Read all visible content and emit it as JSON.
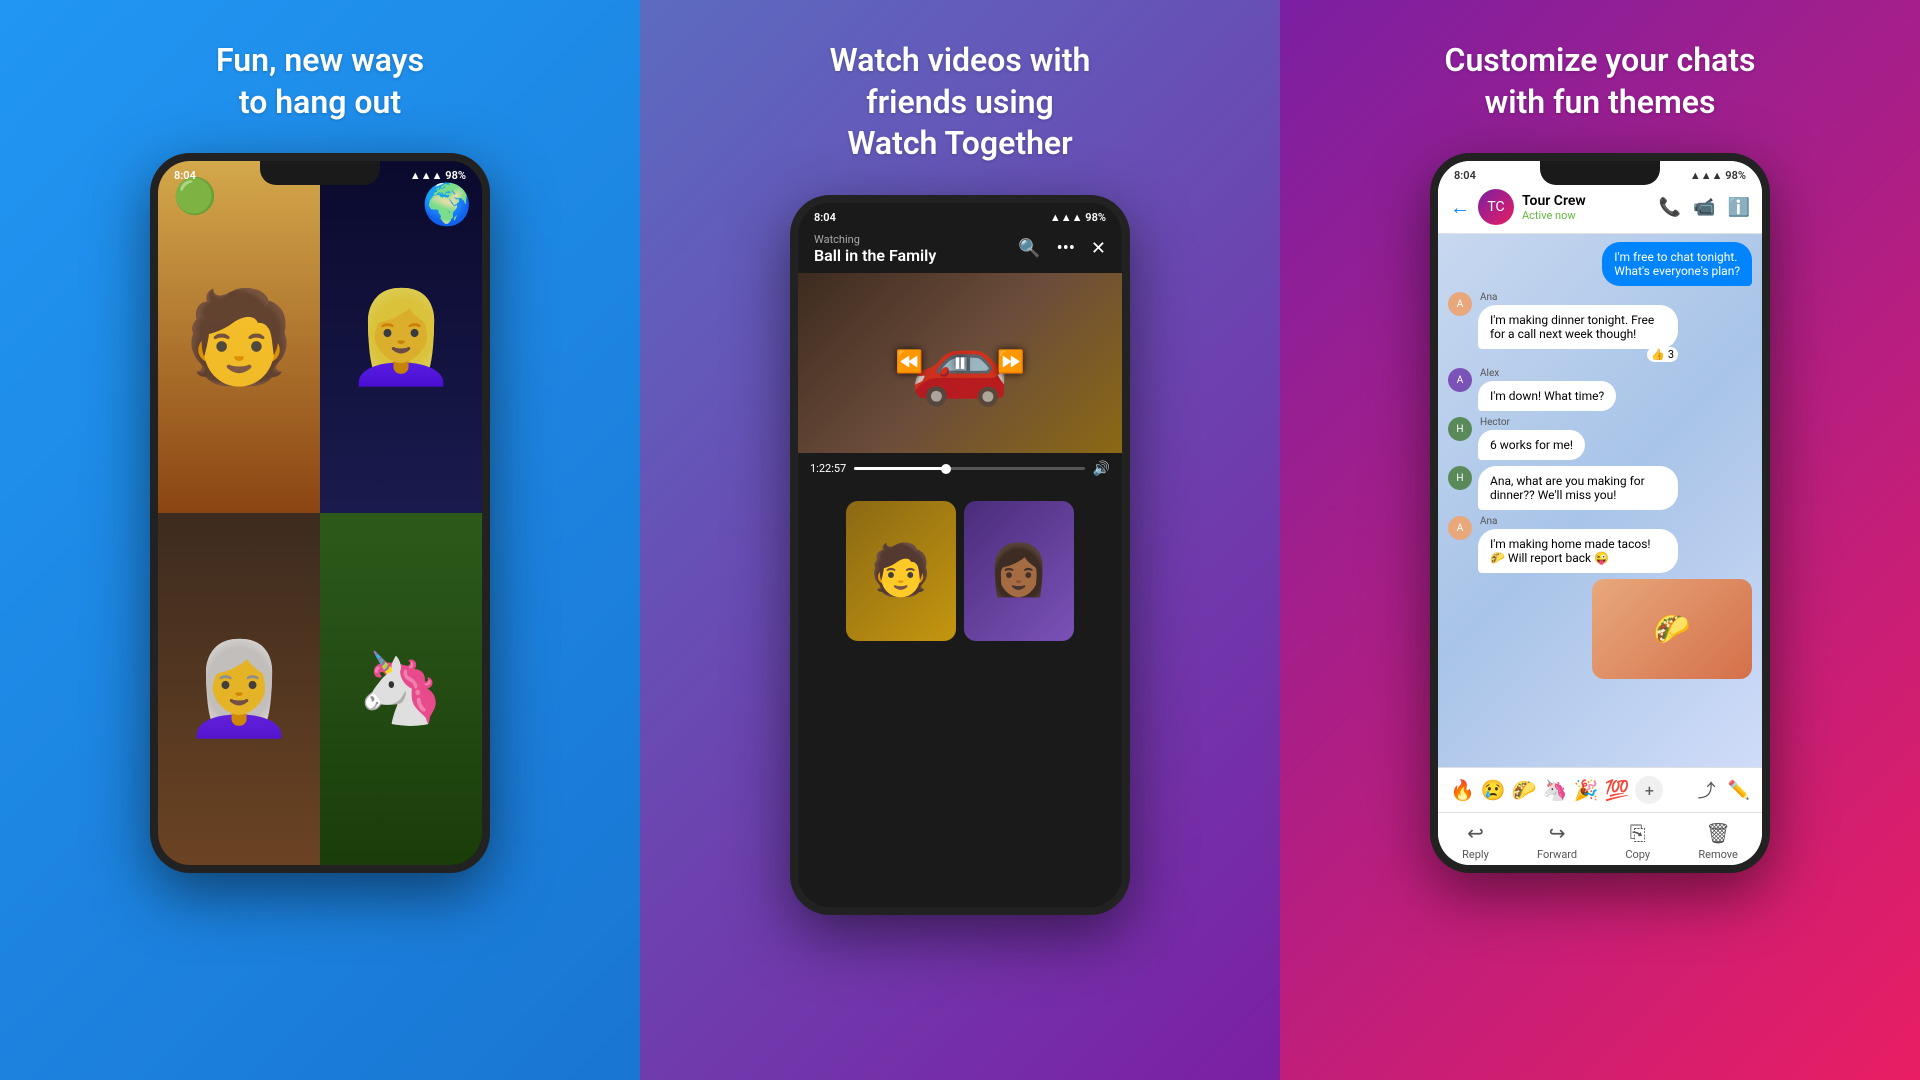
{
  "panels": [
    {
      "id": "panel-1",
      "title": "Fun, new ways\nto hang out",
      "background": "blue"
    },
    {
      "id": "panel-2",
      "title": "Watch videos with\nfriends using\nWatch Together",
      "background": "purple"
    },
    {
      "id": "panel-3",
      "title": "Customize your chats\nwith fun themes",
      "background": "pink-purple"
    }
  ],
  "phone1": {
    "status_bar": {
      "time": "8:04",
      "battery": "98%"
    }
  },
  "phone2": {
    "status_bar": {
      "time": "8:04",
      "battery": "98%"
    },
    "watching_label": "Watching",
    "video_title": "Ball in the Family",
    "timestamp": "1:22:57"
  },
  "phone3": {
    "status_bar": {
      "time": "8:04",
      "battery": "98%"
    },
    "chat": {
      "group_name": "Tour Crew",
      "group_status": "Active now",
      "messages": [
        {
          "type": "sent",
          "text": "I'm free to chat tonight. What's everyone's plan?"
        },
        {
          "type": "received",
          "sender": "Ana",
          "text": "I'm making dinner tonight. Free for a call next week though!",
          "reaction": "👍 3"
        },
        {
          "type": "received",
          "sender": "Alex",
          "text": "I'm down! What time?"
        },
        {
          "type": "received",
          "sender": "Hector",
          "text": "6 works for me!"
        },
        {
          "type": "received",
          "sender": "Hector",
          "text": "Ana, what are you making for dinner?? We'll miss you!"
        },
        {
          "type": "received",
          "sender": "Ana",
          "text": "I'm making home made tacos! 🌮 Will report back 😜"
        }
      ],
      "reactions": [
        "🔥",
        "😢",
        "🌮",
        "🦄",
        "🎉",
        "💯"
      ]
    },
    "bottom_actions": [
      {
        "icon": "↩",
        "label": "Reply"
      },
      {
        "icon": "→",
        "label": "Forward"
      },
      {
        "icon": "⎘",
        "label": "Copy"
      },
      {
        "icon": "🗑",
        "label": "Remove"
      }
    ]
  }
}
